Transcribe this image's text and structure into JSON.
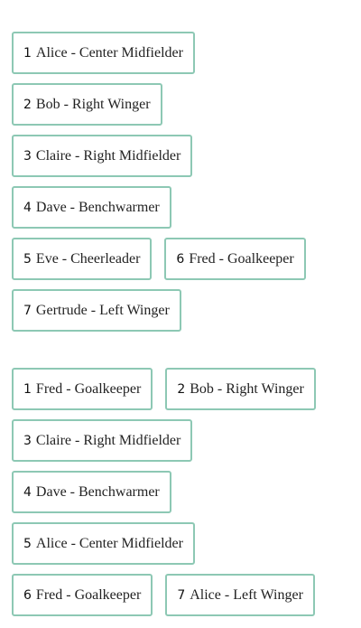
{
  "groups": [
    {
      "rows": [
        [
          {
            "num": "1",
            "label": "Alice - Center Midfielder"
          }
        ],
        [
          {
            "num": "2",
            "label": "Bob - Right Winger"
          }
        ],
        [
          {
            "num": "3",
            "label": "Claire - Right Midfielder"
          }
        ],
        [
          {
            "num": "4",
            "label": "Dave - Benchwarmer"
          }
        ],
        [
          {
            "num": "5",
            "label": "Eve - Cheerleader"
          },
          {
            "num": "6",
            "label": "Fred - Goalkeeper"
          }
        ],
        [
          {
            "num": "7",
            "label": "Gertrude - Left Winger"
          }
        ]
      ]
    },
    {
      "rows": [
        [
          {
            "num": "1",
            "label": "Fred - Goalkeeper"
          },
          {
            "num": "2",
            "label": "Bob - Right Winger"
          }
        ],
        [
          {
            "num": "3",
            "label": "Claire - Right Midfielder"
          }
        ],
        [
          {
            "num": "4",
            "label": "Dave - Benchwarmer"
          }
        ],
        [
          {
            "num": "5",
            "label": "Alice - Center Midfielder"
          }
        ],
        [
          {
            "num": "6",
            "label": "Fred - Goalkeeper"
          },
          {
            "num": "7",
            "label": "Alice - Left Winger"
          }
        ]
      ]
    }
  ],
  "colors": {
    "chip_border": "#8dc8b4",
    "text": "#222222",
    "background": "#ffffff"
  }
}
